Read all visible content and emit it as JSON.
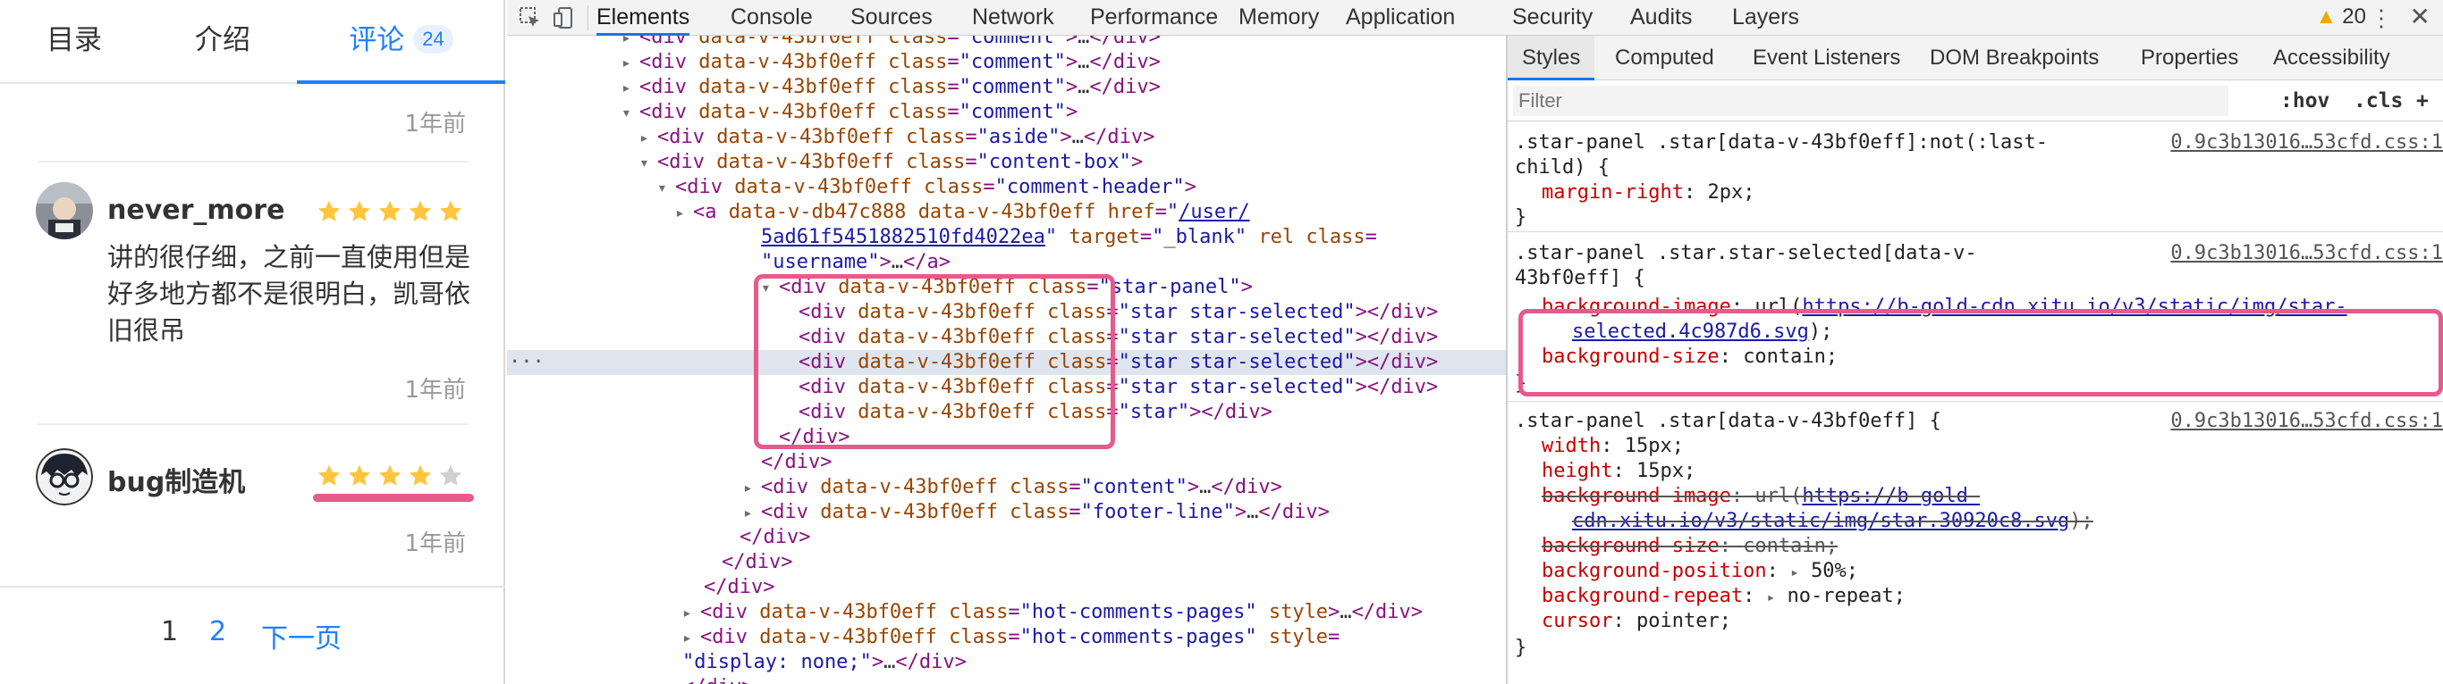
{
  "left": {
    "tabs": [
      {
        "label": "目录"
      },
      {
        "label": "介绍"
      },
      {
        "label": "评论",
        "count": "24"
      }
    ],
    "comments": [
      {
        "time": "1年前"
      },
      {
        "username": "never_more",
        "rating": 5,
        "max": 5,
        "text": "讲的很仔细，之前一直使用但是好多地方都不是很明白，凯哥依旧很吊",
        "time": "1年前"
      },
      {
        "username": "bug制造机",
        "rating": 4,
        "max": 5,
        "time": "1年前"
      }
    ],
    "pager": {
      "page1": "1",
      "page2": "2",
      "next": "下一页"
    }
  },
  "devtools": {
    "tabs": [
      "Elements",
      "Console",
      "Sources",
      "Network",
      "Performance",
      "Memory",
      "Application",
      "Security",
      "Audits",
      "Layers"
    ],
    "warnings": "20",
    "styles_tabs": [
      "Styles",
      "Computed",
      "Event Listeners",
      "DOM Breakpoints",
      "Properties",
      "Accessibility"
    ],
    "filter_placeholder": "Filter",
    "hov": ":hov",
    "cls": ".cls",
    "add": "+",
    "dom": {
      "attr": "data-v-43bf0eff",
      "attr2": "data-v-db47c888",
      "href": "/user/",
      "href2": "5ad61f5451882510fd4022ea",
      "lines": {
        "comment": "comment",
        "aside": "aside",
        "content_box": "content-box",
        "comment_header": "comment-header",
        "star_panel": "star-panel",
        "star_selected": "star star-selected",
        "star": "star",
        "content": "content",
        "footer_line": "footer-line",
        "hot_pages": "hot-comments-pages",
        "display_none": "\"display: none;\"",
        "target": "\"_blank\"",
        "username": "\"username\""
      }
    },
    "rules": [
      {
        "selector": ".star-panel .star[data-v-43bf0eff]:not(:last-",
        "selector2": "child) {",
        "source": "0.9c3b13016…53cfd.css:1",
        "props": [
          {
            "name": "margin-right",
            "value": "2px;"
          }
        ]
      },
      {
        "selector": ".star-panel .star.star-selected[data-v-",
        "selector2": "43bf0eff] {",
        "source": "0.9c3b13016…53cfd.css:1",
        "props": [
          {
            "name": "background-image",
            "value": "https://b-gold-cdn.xitu.io/v3/static/img/star-",
            "value2": "selected.4c987d6.svg"
          },
          {
            "name": "background-size",
            "value": "contain;"
          }
        ]
      },
      {
        "selector": ".star-panel .star[data-v-43bf0eff] {",
        "source": "0.9c3b13016…53cfd.css:1",
        "props": [
          {
            "name": "width",
            "value": "15px;"
          },
          {
            "name": "height",
            "value": "15px;"
          },
          {
            "name": "background-image",
            "value": "https://b-gold-",
            "value2": "cdn.xitu.io/v3/static/img/star.30920c8.svg"
          },
          {
            "name": "background-size",
            "value": "contain;"
          },
          {
            "name": "background-position",
            "value": "50%;"
          },
          {
            "name": "background-repeat",
            "value": "no-repeat;"
          },
          {
            "name": "cursor",
            "value": "pointer;"
          }
        ]
      }
    ]
  },
  "colors": {
    "accent": "#1e80ff",
    "star": "#ffc53d",
    "highlight": "#e75a8b"
  }
}
